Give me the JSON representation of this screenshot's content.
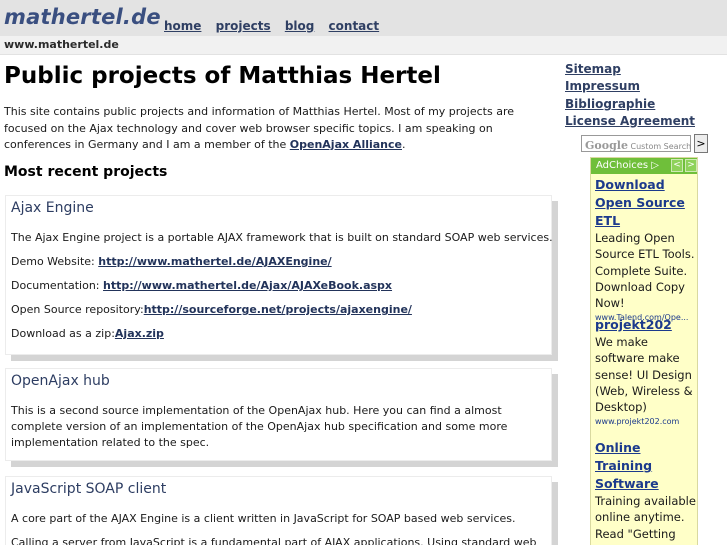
{
  "header": {
    "logo": "mathertel.de",
    "nav": [
      "home",
      "projects",
      "blog",
      "contact"
    ],
    "site_url": "www.mathertel.de"
  },
  "main": {
    "title": "Public projects of Matthias Hertel",
    "intro_text": "This site contains public projects and information of Matthias Hertel. Most of my projects are focused on the Ajax technology and cover web browser specific topics. I am speaking on conferences in Germany and I am a member of the ",
    "intro_link": "OpenAjax Alliance",
    "intro_end": ".",
    "recent_heading": "Most recent projects",
    "projects": [
      {
        "title": "Ajax Engine",
        "description": "The Ajax Engine project is a portable AJAX framework that is built on standard SOAP web services.",
        "demo_label": "Demo Website: ",
        "demo_link": "http://www.mathertel.de/AJAXEngine/",
        "doc_label": "Documentation: ",
        "doc_link": "http://www.mathertel.de/Ajax/AJAXeBook.aspx",
        "repo_label": "Open Source repository:",
        "repo_link": "http://sourceforge.net/projects/ajaxengine/",
        "zip_label": "Download as a zip:",
        "zip_link": "Ajax.zip"
      },
      {
        "title": "OpenAjax hub",
        "description": "This is a second source implementation of the OpenAjax hub. Here you can find a almost complete version of an implementation of the OpenAjax hub specification and some more implementation related to the spec."
      },
      {
        "title": "JavaScript SOAP client",
        "description": "A core part of the AJAX Engine is a client written in JavaScript for SOAP based web services.",
        "description2": "Calling a server from JavaScript is a fundamental part of AJAX applications. Using standard web"
      }
    ]
  },
  "sidebar": {
    "links": [
      "Sitemap",
      "Impressum",
      "Bibliographie",
      "License Agreement"
    ],
    "search": {
      "brand": "Google",
      "placeholder": "Custom Search",
      "button": ">"
    },
    "ads": {
      "adchoices": "AdChoices ▷",
      "items": [
        {
          "title": "Download Open Source ETL",
          "text": "Leading Open Source ETL Tools. Complete Suite. Download Copy Now!",
          "url": "www.Talend.com/Ope..."
        },
        {
          "title": "projekt202",
          "text": "We make software make sense! UI Design (Web, Wireless & Desktop)",
          "url": "www.projekt202.com"
        },
        {
          "title": "Online Training Software",
          "text": "Training available online anytime. Read \"Getting Started\"",
          "url": ""
        }
      ]
    }
  }
}
